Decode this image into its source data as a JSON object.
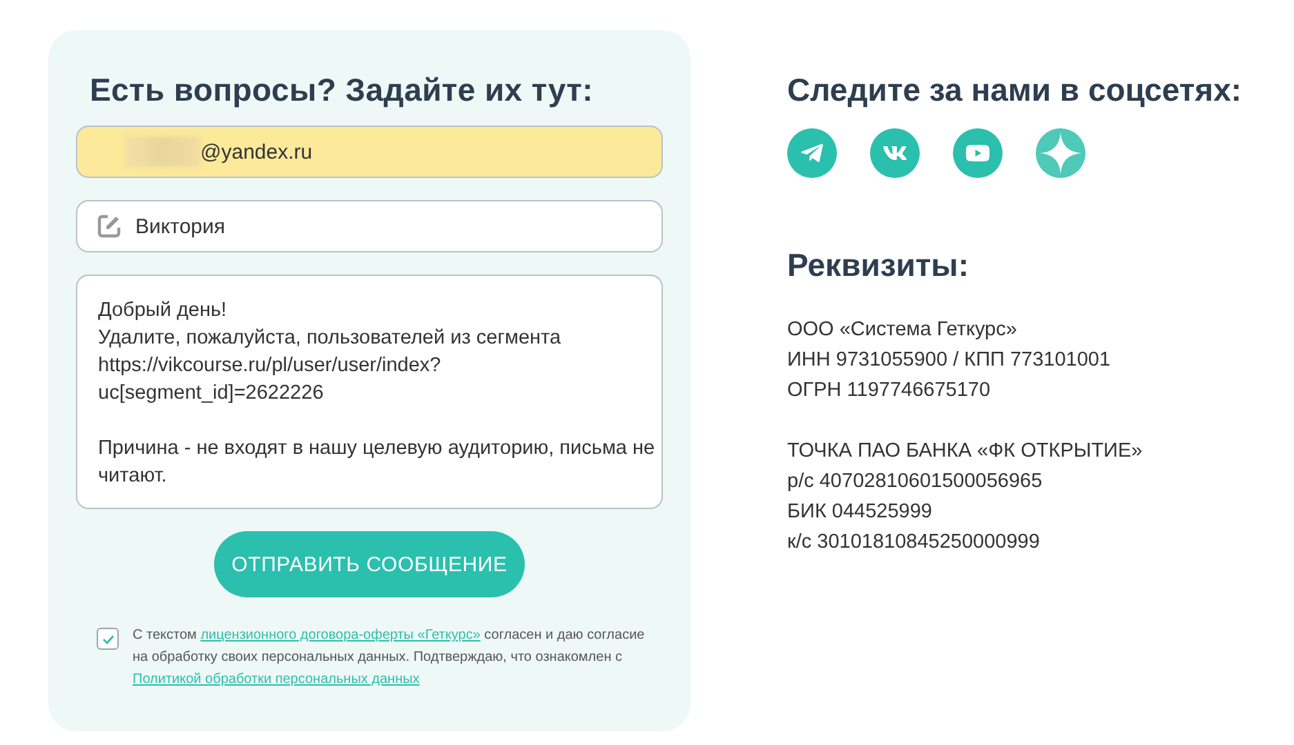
{
  "form": {
    "title": "Есть вопросы? Задайте их тут:",
    "email": {
      "value": "@yandex.ru",
      "redacted": true
    },
    "name": {
      "value": "Виктория"
    },
    "message": {
      "paragraphs": [
        [
          "Добрый день!",
          "Удалите, пожалуйста, пользователей из сегмента",
          "https://vikcourse.ru/pl/user/user/index?",
          "uc[segment_id]=2622226"
        ],
        [
          "Причина - не входят в нашу целевую аудиторию, письма не",
          "читают."
        ]
      ]
    },
    "submit": "ОТПРАВИТЬ СООБЩЕНИЕ",
    "consent": {
      "checked": true,
      "parts": [
        {
          "kind": "text",
          "text": "С текстом "
        },
        {
          "kind": "link",
          "text": "лицензионного договора-оферты «Геткурс»"
        },
        {
          "kind": "text",
          "text": " согласен и даю согласие на обработку своих персональных данных. Подтверждаю, что ознакомлен с "
        },
        {
          "kind": "link",
          "text": "Политикой обработки персональных данных"
        }
      ]
    }
  },
  "social": {
    "title": "Следите за нами в соцсетях:",
    "icons": [
      {
        "kind": "telegram"
      },
      {
        "kind": "vk"
      },
      {
        "kind": "youtube"
      },
      {
        "kind": "star"
      }
    ]
  },
  "requisites": {
    "title": "Реквизиты:",
    "blocks": [
      [
        "ООО «Система Геткурс»",
        "ИНН 9731055900 / КПП 773101001",
        "ОГРН 1197746675170"
      ],
      [
        "ТОЧКА ПАО БАНКА «ФК ОТКРЫТИЕ»",
        "р/с 40702810601500056965",
        "БИК 044525999",
        "к/с 30101810845250000999"
      ]
    ]
  }
}
